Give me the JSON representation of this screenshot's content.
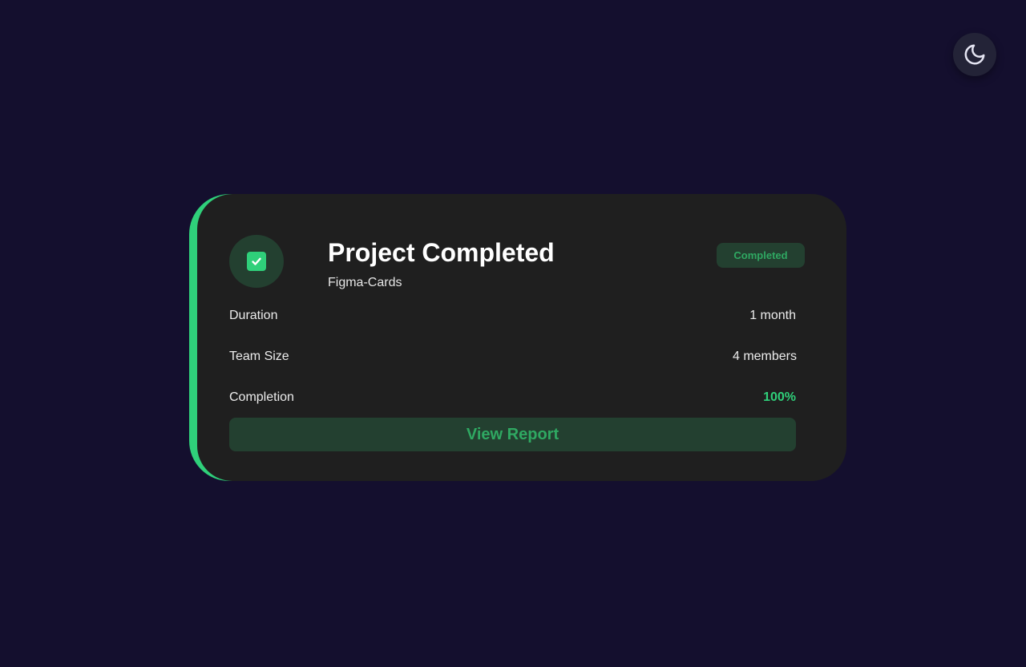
{
  "theme_toggle": {
    "icon": "moon-icon"
  },
  "card": {
    "accent_color": "#2fd07a",
    "status_icon": "check-square-icon",
    "title": "Project Completed",
    "subtitle": "Figma-Cards",
    "badge": "Completed",
    "details": [
      {
        "label": "Duration",
        "value": "1 month"
      },
      {
        "label": "Team Size",
        "value": "4 members"
      },
      {
        "label": "Completion",
        "value": "100%"
      }
    ],
    "button_label": "View Report"
  }
}
